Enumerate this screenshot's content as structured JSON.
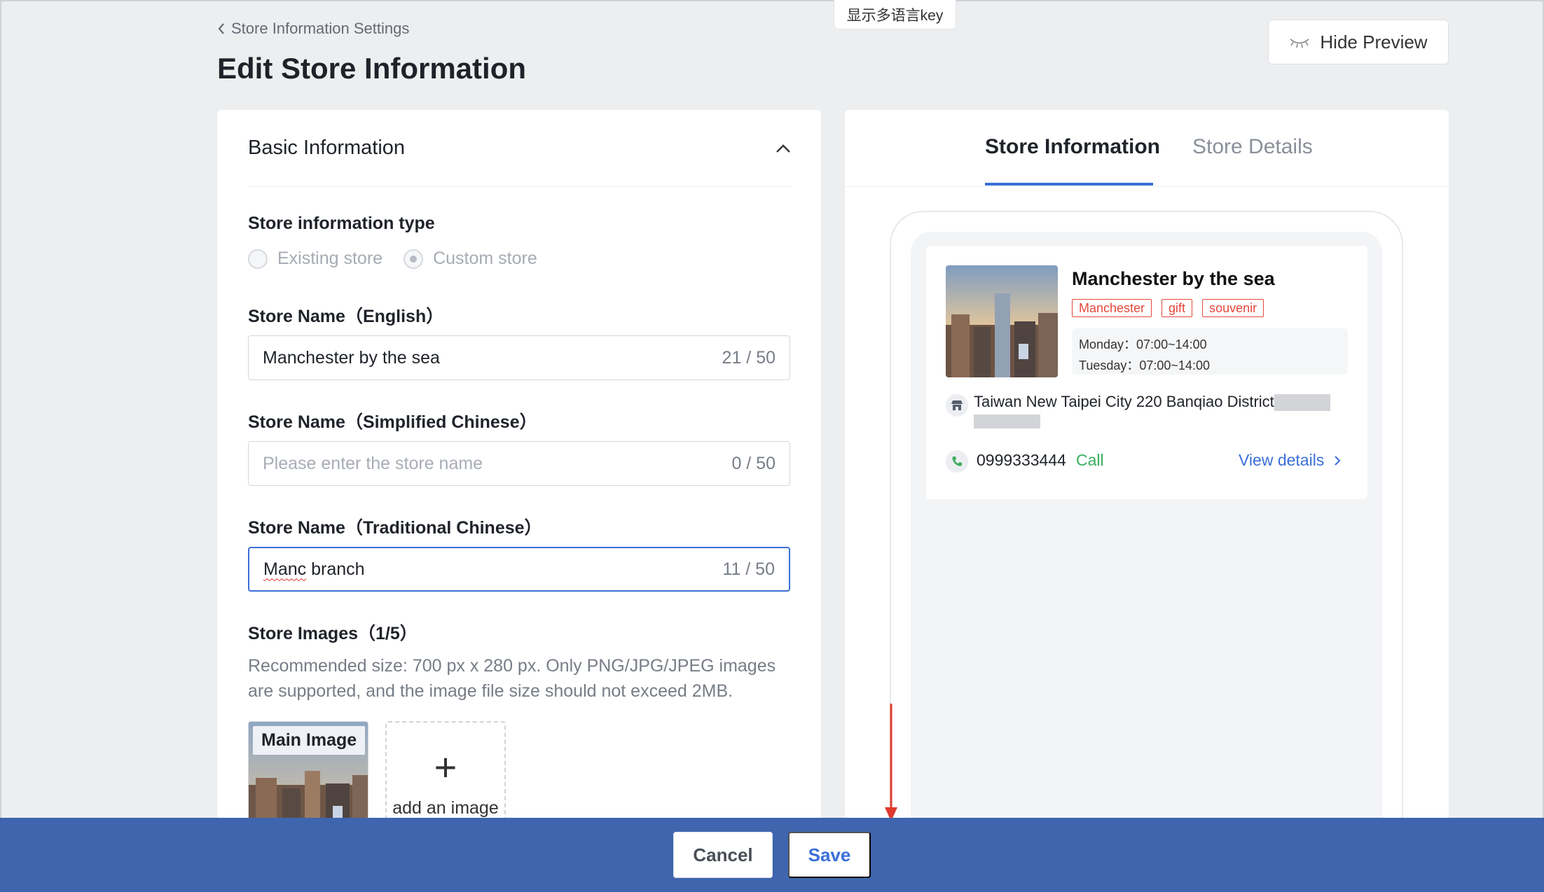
{
  "top": {
    "lang_key": "显示多语言key"
  },
  "header": {
    "breadcrumb": "Store Information Settings",
    "title": "Edit Store Information",
    "hide_preview": "Hide Preview"
  },
  "form": {
    "section_title": "Basic Information",
    "type_label": "Store information type",
    "type_options": [
      "Existing store",
      "Custom store"
    ],
    "type_selected": "Custom store",
    "name_en": {
      "label": "Store Name（English）",
      "value": "Manchester by the sea",
      "counter": "21 / 50"
    },
    "name_sc": {
      "label": "Store Name（Simplified Chinese）",
      "placeholder": "Please enter the store name",
      "counter": "0 / 50"
    },
    "name_tc": {
      "label": "Store Name（Traditional Chinese）",
      "value_first": "Manc",
      "value_rest": " branch",
      "counter": "11 / 50"
    },
    "images": {
      "label": "Store Images（1/5）",
      "hint": "Recommended size: 700 px x 280 px. Only PNG/JPG/JPEG images are supported, and the image file size should not exceed 2MB.",
      "main_badge": "Main Image",
      "add_label": "add an image"
    }
  },
  "preview": {
    "tabs": [
      "Store Information",
      "Store Details"
    ],
    "active_tab": "Store Information",
    "card": {
      "name": "Manchester by the sea",
      "tags": [
        "Manchester",
        "gift",
        "souvenir"
      ],
      "hours": [
        "Monday：07:00~14:00",
        "Tuesday：07:00~14:00"
      ],
      "address": "Taiwan New Taipei City 220 Banqiao District",
      "phone": "0999333444",
      "call": "Call",
      "view_details": "View details"
    }
  },
  "footer": {
    "cancel": "Cancel",
    "save": "Save"
  },
  "colors": {
    "accent": "#3b6fd8",
    "footer_bg": "#3e65ad",
    "tag_red": "#e4473b",
    "call_green": "#3aad5e",
    "arrow_red": "#e03a2f"
  }
}
